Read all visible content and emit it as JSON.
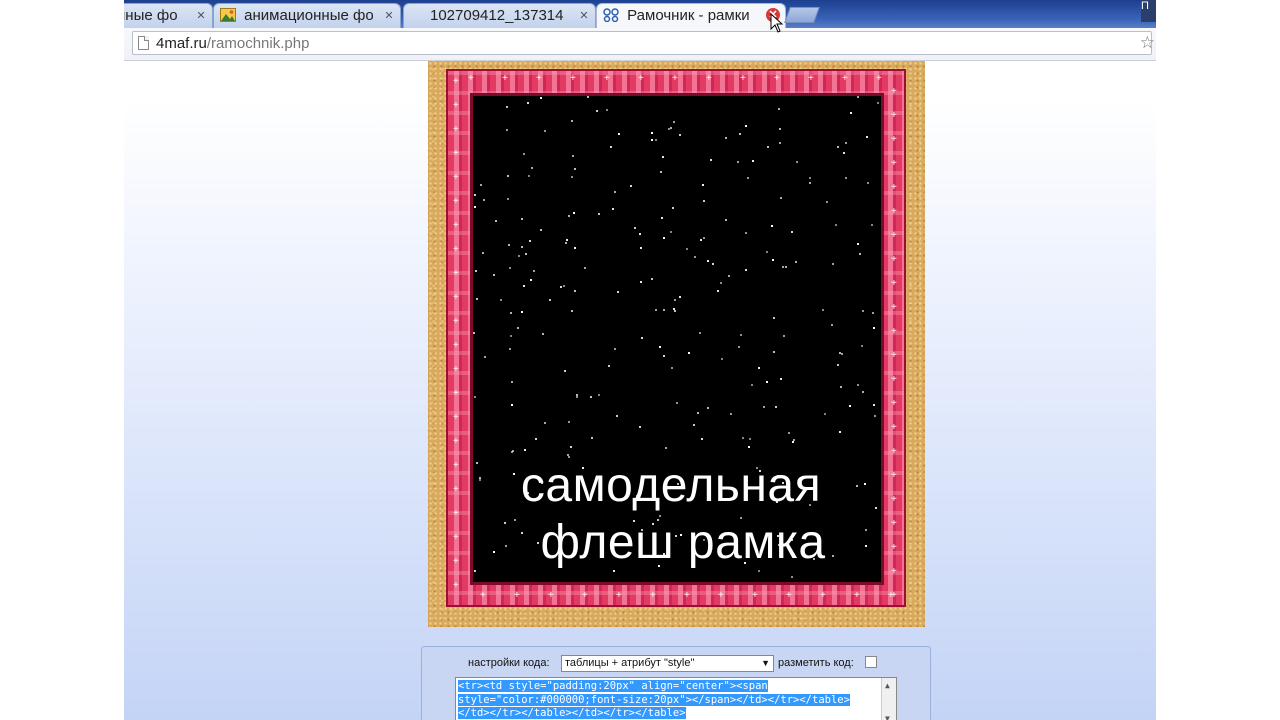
{
  "browser": {
    "tabs": [
      {
        "label": "нные фо",
        "active": false
      },
      {
        "label": "анимационные фо",
        "active": false
      },
      {
        "label": "102709412_137314",
        "active": false
      },
      {
        "label": "Рамочник - рамки",
        "active": true
      }
    ],
    "window_button_label": "П",
    "url_host": "4maf.ru",
    "url_path": "/ramochnik.php"
  },
  "frame_preview": {
    "caption_line1": "самодельная",
    "caption_line2": "флеш рамка",
    "colors": {
      "border_pink": "#e23a62",
      "inner": "#000000",
      "outer_texture": "#d9a95d"
    }
  },
  "settings": {
    "code_settings_label": "настройки кода:",
    "code_settings_value": "таблицы + атрибут \"style\"",
    "mark_code_label": "разметить код:",
    "mark_code_checked": false,
    "code_lines": [
      "<tr><td style=\"padding:20px\" align=\"center\"><span",
      "style=\"color:#000000;font-size:20px\"></span></td></tr></table>",
      "</td></tr></table></td></tr></table>"
    ]
  }
}
